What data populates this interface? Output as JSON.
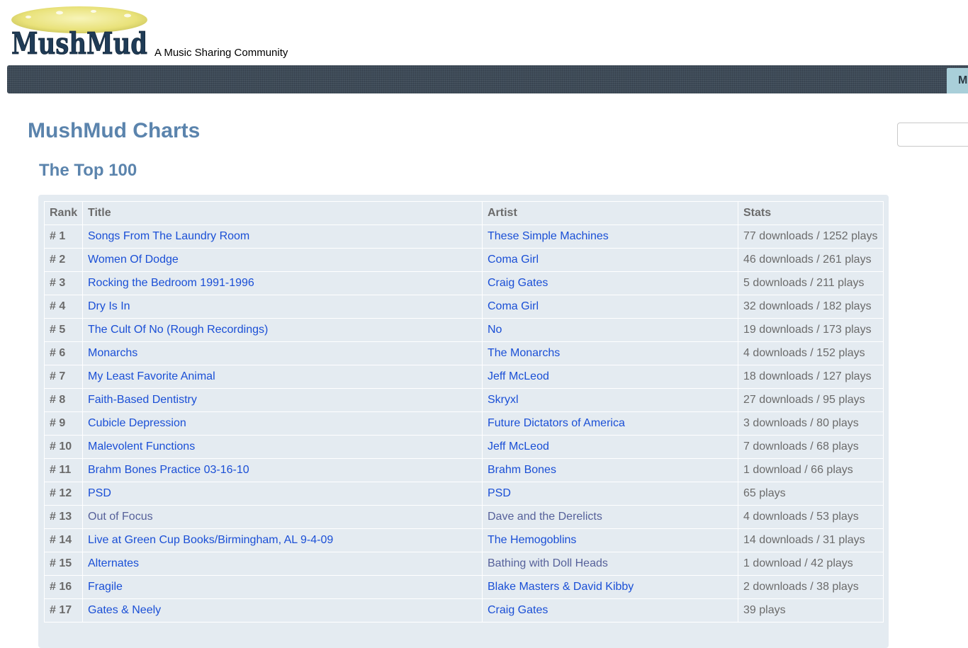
{
  "header": {
    "logo_text": "MushMud",
    "tagline": "A Music Sharing Community"
  },
  "nav": {
    "tab_label": "M"
  },
  "page": {
    "title": "MushMud Charts",
    "section_title": "The Top 100"
  },
  "search": {
    "value": "",
    "placeholder": ""
  },
  "table": {
    "headers": [
      "Rank",
      "Title",
      "Artist",
      "Stats"
    ],
    "rows": [
      {
        "rank": "# 1",
        "title": "Songs From The Laundry Room",
        "artist": "These Simple Machines",
        "stats": "77 downloads / 1252 plays"
      },
      {
        "rank": "# 2",
        "title": "Women Of Dodge",
        "artist": "Coma Girl",
        "stats": "46 downloads / 261 plays"
      },
      {
        "rank": "# 3",
        "title": "Rocking the Bedroom 1991-1996",
        "artist": "Craig Gates",
        "stats": "5 downloads / 211 plays"
      },
      {
        "rank": "# 4",
        "title": "Dry Is In",
        "artist": "Coma Girl",
        "stats": "32 downloads / 182 plays"
      },
      {
        "rank": "# 5",
        "title": "The Cult Of No (Rough Recordings)",
        "artist": "No",
        "stats": "19 downloads / 173 plays"
      },
      {
        "rank": "# 6",
        "title": "Monarchs",
        "artist": "The Monarchs",
        "stats": "4 downloads / 152 plays"
      },
      {
        "rank": "# 7",
        "title": "My Least Favorite Animal",
        "artist": "Jeff McLeod",
        "stats": "18 downloads / 127 plays"
      },
      {
        "rank": "# 8",
        "title": "Faith-Based Dentistry",
        "artist": "Skryxl",
        "stats": "27 downloads / 95 plays"
      },
      {
        "rank": "# 9",
        "title": "Cubicle Depression",
        "artist": "Future Dictators of America",
        "stats": "3 downloads / 80 plays"
      },
      {
        "rank": "# 10",
        "title": "Malevolent Functions",
        "artist": "Jeff McLeod",
        "stats": "7 downloads / 68 plays"
      },
      {
        "rank": "# 11",
        "title": "Brahm Bones Practice 03-16-10",
        "artist": "Brahm Bones",
        "stats": "1 download / 66 plays"
      },
      {
        "rank": "# 12",
        "title": "PSD",
        "artist": "PSD",
        "stats": "65 plays"
      },
      {
        "rank": "# 13",
        "title": "Out of Focus",
        "artist": "Dave and the Derelicts",
        "stats": "4 downloads / 53 plays",
        "title_visited": true,
        "artist_visited": true
      },
      {
        "rank": "# 14",
        "title": "Live at Green Cup Books/Birmingham, AL 9-4-09",
        "artist": "The Hemogoblins",
        "stats": "14 downloads / 31 plays"
      },
      {
        "rank": "# 15",
        "title": "Alternates",
        "artist": "Bathing with Doll Heads",
        "stats": "1 download / 42 plays",
        "artist_visited": true
      },
      {
        "rank": "# 16",
        "title": "Fragile",
        "artist": "Blake Masters & David Kibby",
        "stats": "2 downloads / 38 plays"
      },
      {
        "rank": "# 17",
        "title": "Gates & Neely",
        "artist": "Craig Gates",
        "stats": "39 plays"
      }
    ]
  },
  "colors": {
    "heading": "#5b84ad",
    "link": "#1a4fd6",
    "visited_link": "#56619a",
    "muted_text": "#6b6b6b",
    "nav_bg": "#3d4a57",
    "nav_tab": "#a9cfd9",
    "table_bg": "#e4ebf1"
  }
}
